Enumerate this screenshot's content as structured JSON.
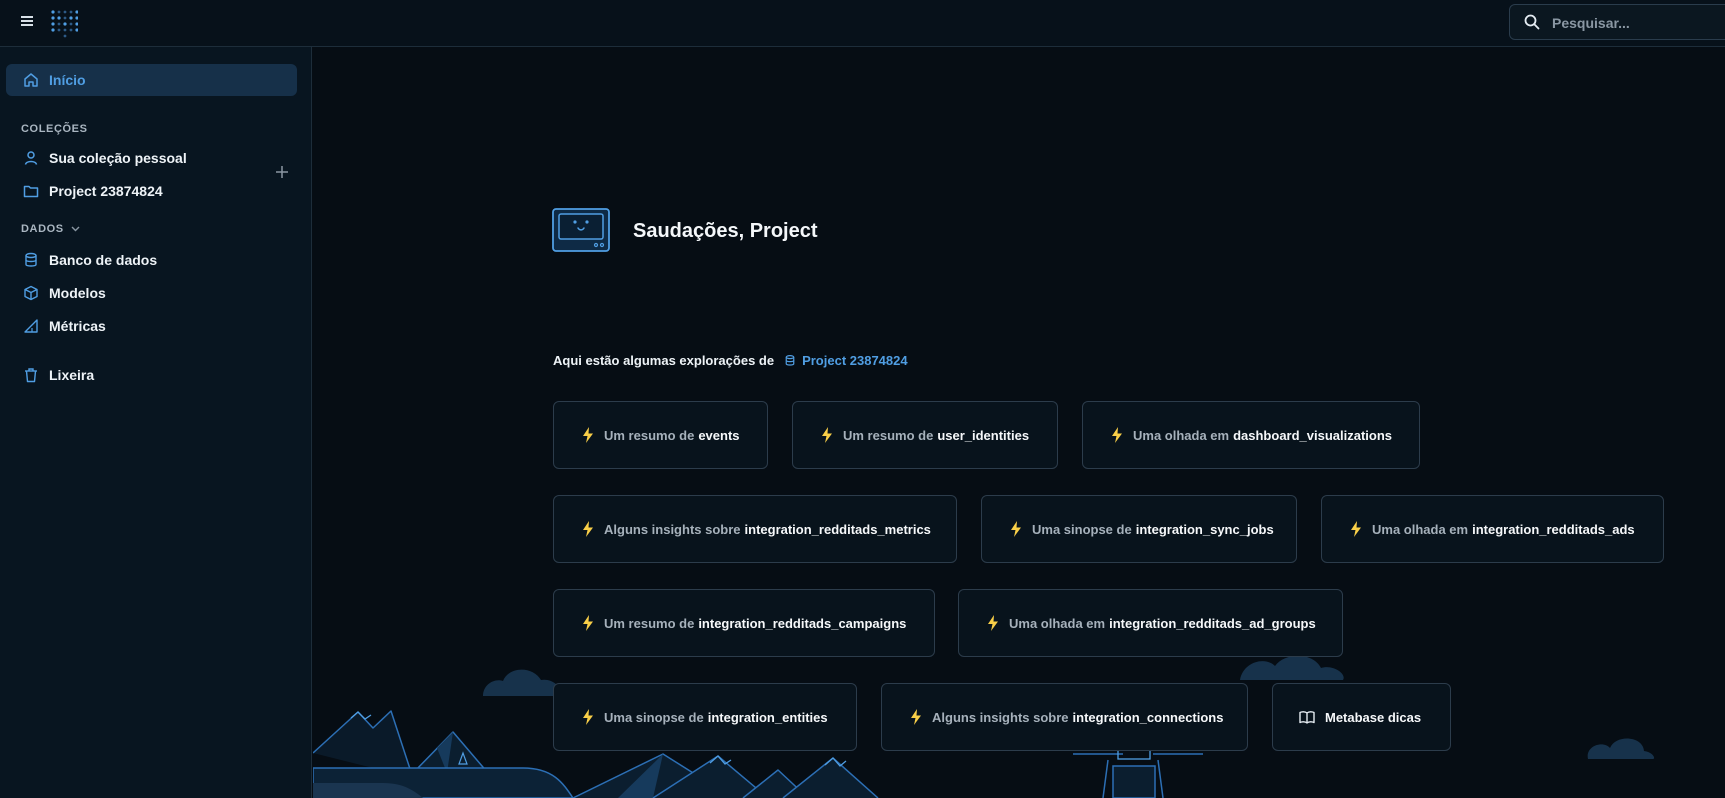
{
  "search": {
    "placeholder": "Pesquisar..."
  },
  "sidebar": {
    "home": {
      "label": "Início",
      "icon": "home-icon"
    },
    "collections_label": "COLEÇÕES",
    "collections": [
      {
        "label": "Sua coleção pessoal",
        "icon": "person-icon"
      },
      {
        "label": "Project 23874824",
        "icon": "folder-icon"
      }
    ],
    "data_label": "DADOS",
    "data_items": [
      {
        "label": "Banco de dados",
        "icon": "database-icon"
      },
      {
        "label": "Modelos",
        "icon": "cube-icon"
      },
      {
        "label": "Métricas",
        "icon": "metric-icon"
      }
    ],
    "trash": {
      "label": "Lixeira",
      "icon": "trash-icon"
    }
  },
  "main": {
    "greeting": "Saudações, Project",
    "explorations_prefix": "Aqui estão algumas explorações de",
    "database_name": "Project 23874824",
    "cards": [
      {
        "prefix": "Um resumo de",
        "table": "events"
      },
      {
        "prefix": "Um resumo de",
        "table": "user_identities"
      },
      {
        "prefix": "Uma olhada em",
        "table": "dashboard_visualizations"
      },
      {
        "prefix": "Alguns insights sobre",
        "table": "integration_redditads_metrics"
      },
      {
        "prefix": "Uma sinopse de",
        "table": "integration_sync_jobs"
      },
      {
        "prefix": "Uma olhada em",
        "table": "integration_redditads_ads"
      },
      {
        "prefix": "Um resumo de",
        "table": "integration_redditads_campaigns"
      },
      {
        "prefix": "Uma olhada em",
        "table": "integration_redditads_ad_groups"
      },
      {
        "prefix": "Uma sinopse de",
        "table": "integration_entities"
      },
      {
        "prefix": "Alguns insights sobre",
        "table": "integration_connections"
      }
    ],
    "tips_card": {
      "label": "Metabase dicas",
      "icon": "book-icon"
    }
  },
  "colors": {
    "accent": "#509ee3",
    "bolt": "#f9cf48",
    "background": "#060d14",
    "sidebar": "#081520",
    "card_border": "#2c3c4b"
  }
}
